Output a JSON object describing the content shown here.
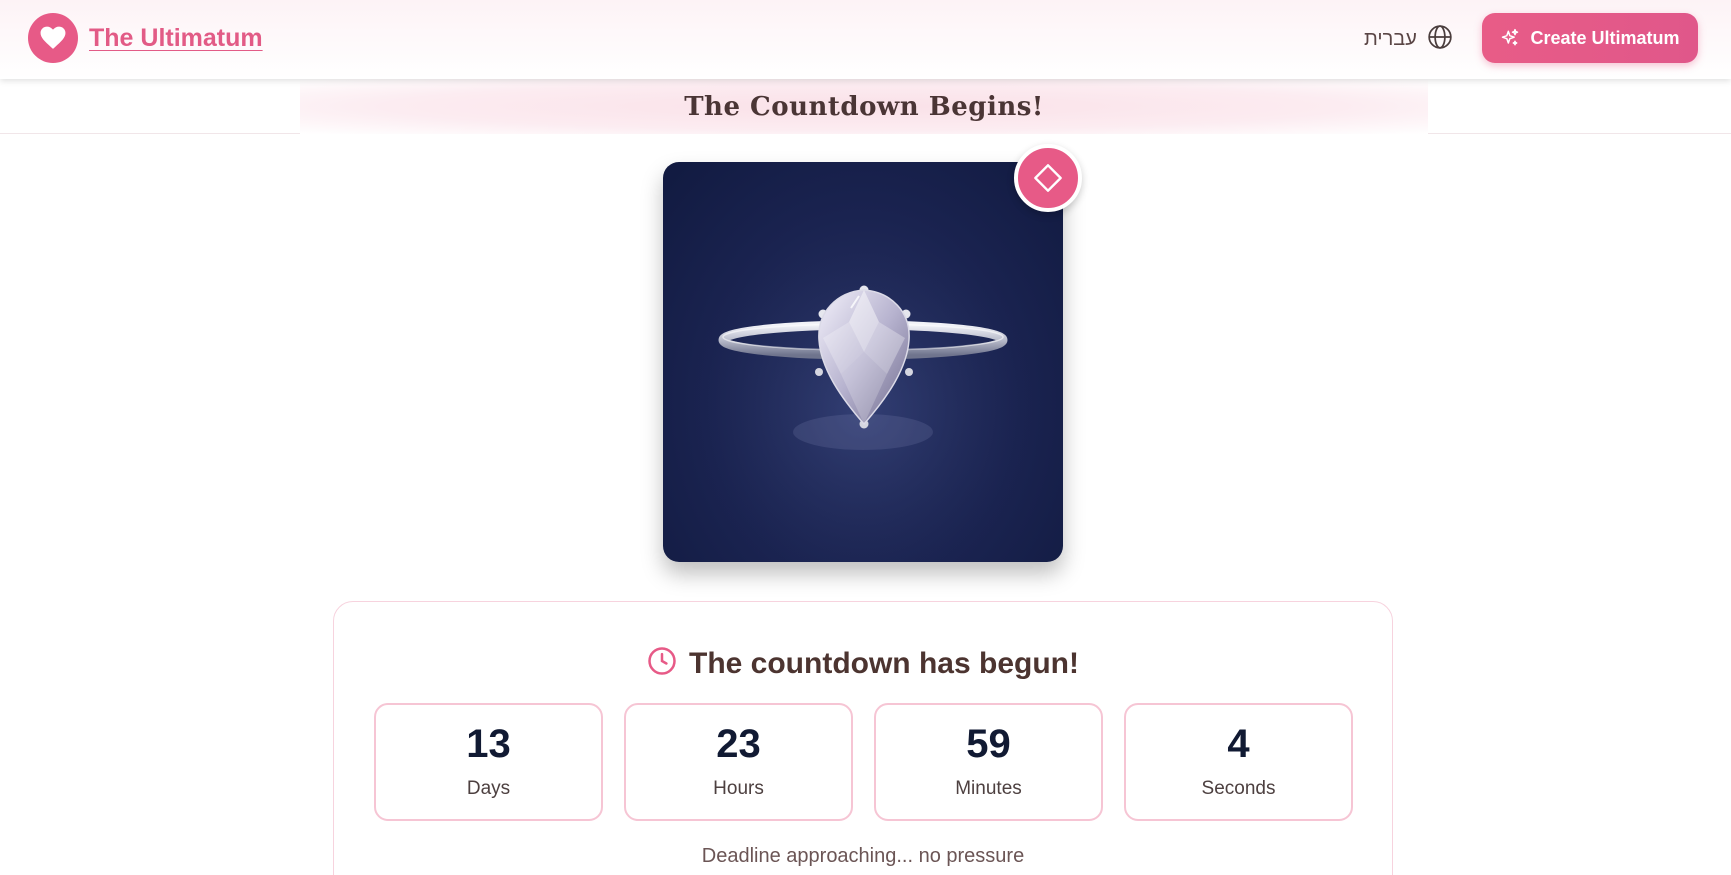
{
  "header": {
    "brand_name": "The Ultimatum",
    "logo_icon": "heart-icon",
    "language_label": "עברית",
    "language_icon": "globe-icon",
    "create_button_label": "Create Ultimatum",
    "create_button_icon": "sparkle-icon"
  },
  "banner": {
    "title": "The Countdown Begins!"
  },
  "ring_image": {
    "badge_icon": "diamond-icon"
  },
  "countdown": {
    "title": "The countdown has begun!",
    "title_icon": "clock-icon",
    "units": [
      {
        "value": "13",
        "label": "Days"
      },
      {
        "value": "23",
        "label": "Hours"
      },
      {
        "value": "59",
        "label": "Minutes"
      },
      {
        "value": "4",
        "label": "Seconds"
      }
    ],
    "note": "Deadline approaching... no pressure"
  },
  "colors": {
    "accent": "#e75a87",
    "card_border": "#f6c5d4",
    "dark_text": "#111a33"
  }
}
